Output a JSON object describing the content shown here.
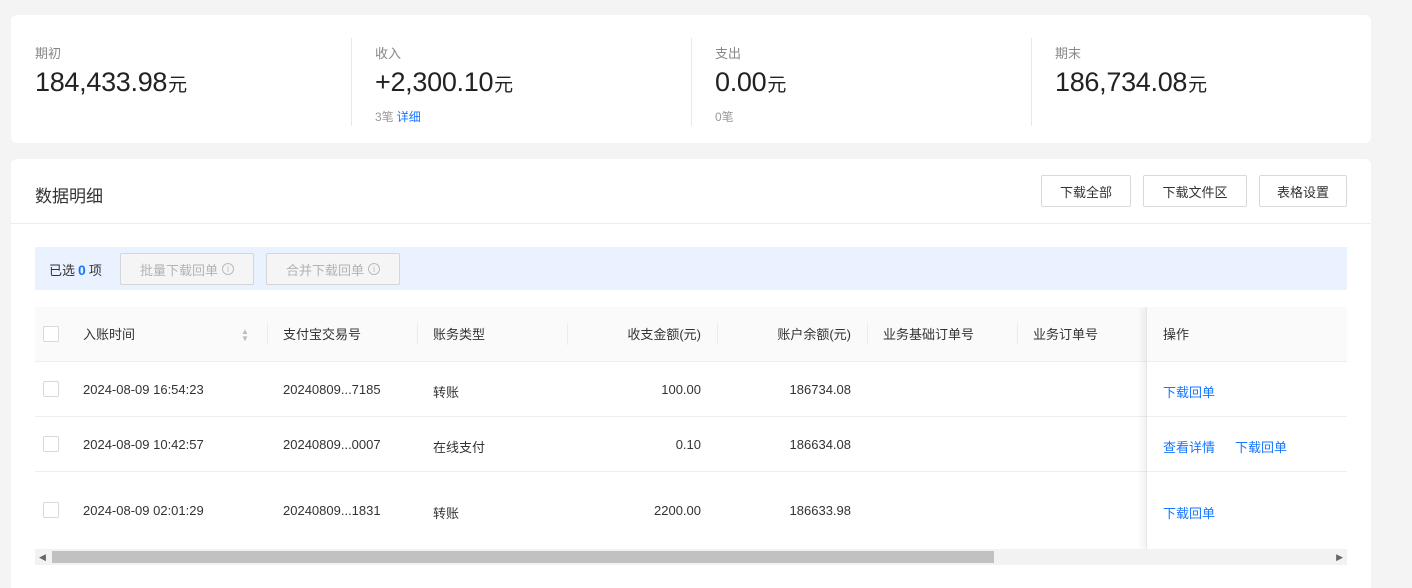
{
  "summary": {
    "opening": {
      "label": "期初",
      "value": "184,433.98",
      "unit": "元"
    },
    "income": {
      "label": "收入",
      "value": "+2,300.10",
      "unit": "元",
      "count": "3笔",
      "detail_link": "详细"
    },
    "expense": {
      "label": "支出",
      "value": "0.00",
      "unit": "元",
      "count": "0笔"
    },
    "closing": {
      "label": "期末",
      "value": "186,734.08",
      "unit": "元"
    }
  },
  "detail": {
    "title": "数据明细",
    "buttons": {
      "download_all": "下载全部",
      "download_files": "下载文件区",
      "table_settings": "表格设置"
    },
    "selection": {
      "prefix": "已选",
      "count": "0",
      "suffix": "项",
      "batch_download": "批量下载回单",
      "merge_download": "合并下载回单",
      "info_glyph": "i"
    },
    "columns": [
      "入账时间",
      "支付宝交易号",
      "账务类型",
      "收支金额(元)",
      "账户余额(元)",
      "业务基础订单号",
      "业务订单号",
      "操作"
    ],
    "rows": [
      {
        "time": "2024-08-09 16:54:23",
        "trade_no": "20240809...7185",
        "type": "转账",
        "amount": "100.00",
        "balance": "186734.08",
        "base_order": "",
        "order": "",
        "actions": [
          "下载回单"
        ]
      },
      {
        "time": "2024-08-09 10:42:57",
        "trade_no": "20240809...0007",
        "type": "在线支付",
        "amount": "0.10",
        "balance": "186634.08",
        "base_order": "",
        "order": "",
        "actions": [
          "查看详情",
          "下载回单"
        ]
      },
      {
        "time": "2024-08-09 02:01:29",
        "trade_no": "20240809...1831",
        "type": "转账",
        "amount": "2200.00",
        "balance": "186633.98",
        "base_order": "",
        "order": "",
        "actions": [
          "下载回单"
        ]
      }
    ]
  },
  "icons": {
    "sort": "sort-icon",
    "info": "info-icon",
    "scroll_left": "scroll-left-arrow-icon",
    "scroll_right": "scroll-right-arrow-icon"
  },
  "colors": {
    "accent": "#1677ff",
    "selection_bar": "#e9f2fe",
    "page_bg": "#f4f4f4"
  }
}
